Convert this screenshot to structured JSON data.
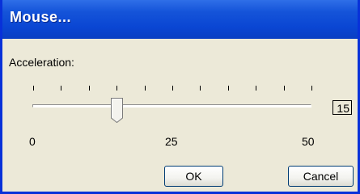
{
  "window": {
    "title": "Mouse..."
  },
  "acceleration": {
    "label": "Acceleration:",
    "value": 15,
    "value_text": "15",
    "min": 0,
    "max": 50,
    "scale_labels": [
      "0",
      "25",
      "50"
    ],
    "tick_count": 11
  },
  "buttons": {
    "ok": "OK",
    "cancel": "Cancel"
  },
  "colors": {
    "title_bar": "#0a46d3",
    "frame": "#0831d9",
    "dialog_bg": "#ece9d8",
    "button_border": "#003c74"
  }
}
